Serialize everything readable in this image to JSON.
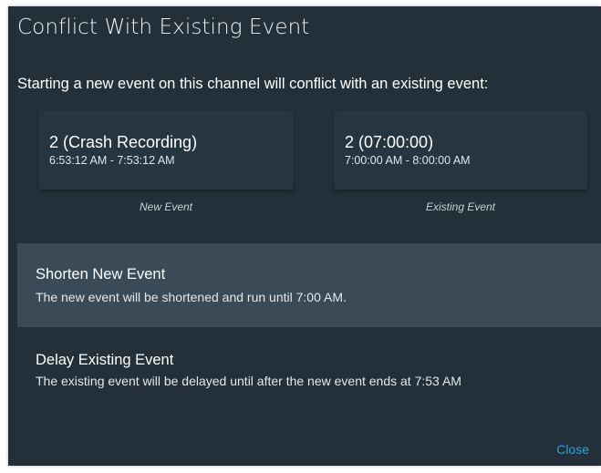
{
  "dialog": {
    "title": "Conflict With Existing Event",
    "message": "Starting a new event on this channel will conflict with an existing event:"
  },
  "events": {
    "new": {
      "name": "2 (Crash Recording)",
      "time_range": "6:53:12 AM - 7:53:12 AM",
      "caption": "New Event"
    },
    "existing": {
      "name": "2 (07:00:00)",
      "time_range": "7:00:00 AM - 8:00:00 AM",
      "caption": "Existing Event"
    }
  },
  "options": {
    "shorten": {
      "title": "Shorten New Event",
      "description": "The new event will be shortened and run until 7:00 AM.",
      "highlighted": true
    },
    "delay": {
      "title": "Delay Existing Event",
      "description": "The existing event will be delayed until after the new event ends at 7:53 AM"
    }
  },
  "actions": {
    "close_label": "Close"
  },
  "colors": {
    "dialog_background": "#233039",
    "highlight": "#3a4b57",
    "accent": "#2aa3dc"
  }
}
